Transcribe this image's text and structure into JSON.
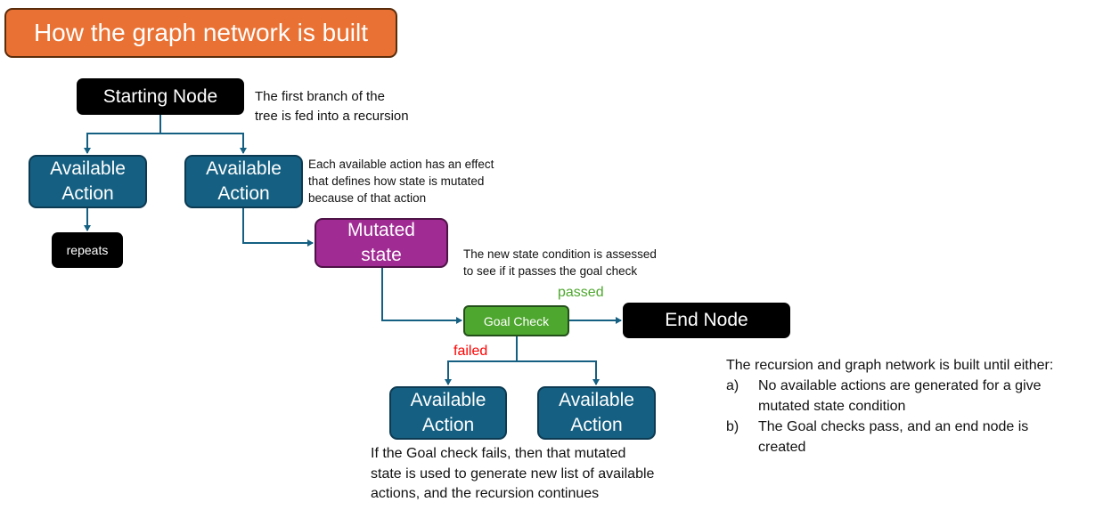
{
  "title": "How the graph network is built",
  "colors": {
    "title_bg": "#e97133",
    "action_bg": "#156082",
    "mutated_bg": "#a02b93",
    "goal_bg": "#4ea72e",
    "black_node_bg": "#000000",
    "connector": "#156082",
    "passed_text": "#4ea72e",
    "failed_text": "#ff0000"
  },
  "nodes": {
    "start": "Starting Node",
    "action_line1": "Available",
    "action_line2": "Action",
    "repeats": "repeats",
    "mutated_line1": "Mutated",
    "mutated_line2": "state",
    "goal_check": "Goal Check",
    "end": "End Node"
  },
  "edge_labels": {
    "passed": "passed",
    "failed": "failed"
  },
  "notes": {
    "start_note": [
      "The first branch of the",
      "tree is fed into a recursion"
    ],
    "action_note": [
      "Each available action has an effect",
      "that defines how state is mutated",
      "because of that action"
    ],
    "mutated_note": [
      "The new state condition is assessed",
      "to see if it passes the goal check"
    ],
    "failed_note": [
      "If the Goal check fails, then that mutated",
      "state is used to generate new list of available",
      "actions, and the recursion continues"
    ]
  },
  "summary": {
    "heading": "The recursion and graph network is built until either:",
    "items": [
      {
        "marker": "a)",
        "lines": [
          "No available actions are generated for a give",
          "mutated state condition"
        ]
      },
      {
        "marker": "b)",
        "lines": [
          "The Goal checks pass, and an end node is",
          "created"
        ]
      }
    ]
  }
}
